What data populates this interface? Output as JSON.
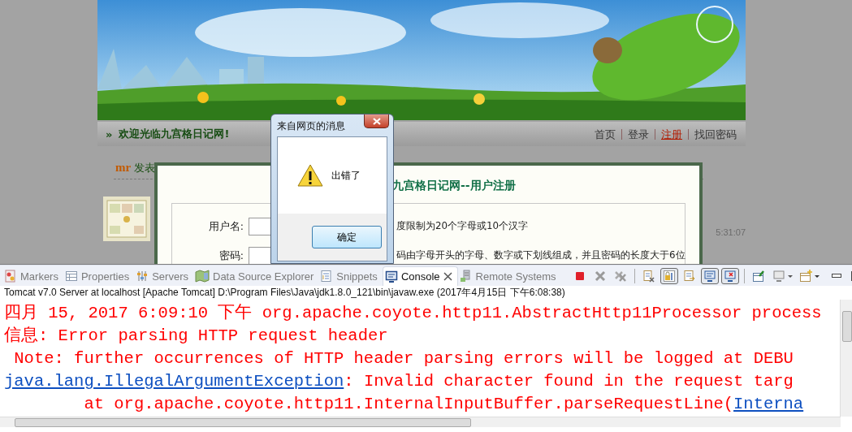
{
  "browser": {
    "welcome_mark": "»",
    "welcome": "欢迎光临九宫格日记网!",
    "nav_links": [
      {
        "label": "首页",
        "selected": false
      },
      {
        "label": "登录",
        "selected": false
      },
      {
        "label": "注册",
        "selected": true
      },
      {
        "label": "找回密码",
        "selected": false
      }
    ],
    "post": {
      "author": "mr",
      "action": "发表",
      "time": "5:31:07"
    },
    "register_dialog": {
      "title": "九宫格日记网--用户注册",
      "fields": [
        {
          "label": "用户名:",
          "hint": "度限制为20个字母或10个汉字"
        },
        {
          "label": "密码:",
          "hint": "码由字母开头的字母、数字或下划线组成，并且密码的长度大于6位"
        }
      ]
    },
    "alert": {
      "title": "来自网页的消息",
      "message": "出错了",
      "button": "确定"
    }
  },
  "ide": {
    "tabs": [
      {
        "label": "Markers",
        "selected": false
      },
      {
        "label": "Properties",
        "selected": false
      },
      {
        "label": "Servers",
        "selected": false
      },
      {
        "label": "Data Source Explorer",
        "selected": false
      },
      {
        "label": "Snippets",
        "selected": false
      },
      {
        "label": "Console",
        "selected": true
      },
      {
        "label": "Remote Systems",
        "selected": false
      }
    ],
    "toolbar": [
      {
        "pressed": false
      },
      {
        "pressed": false
      },
      {
        "pressed": false
      },
      {
        "pressed": false
      },
      {
        "pressed": true
      },
      {
        "pressed": false
      },
      {
        "pressed": true
      },
      {
        "pressed": true
      },
      {
        "pressed": false
      },
      {
        "pressed": false
      },
      {
        "pressed": false
      }
    ],
    "console_title": "Tomcat v7.0 Server at localhost [Apache Tomcat] D:\\Program Files\\Java\\jdk1.8.0_121\\bin\\javaw.exe (2017年4月15日 下午6:08:38)",
    "lines": [
      {
        "segments": [
          {
            "kind": "text",
            "text": "四月 15, 2017 6:09:10 下午 org.apache.coyote.http11.AbstractHttp11Processor process"
          }
        ]
      },
      {
        "segments": [
          {
            "kind": "text",
            "text": "信息: Error parsing HTTP request header"
          }
        ]
      },
      {
        "segments": [
          {
            "kind": "text",
            "text": " Note: further occurrences of HTTP header parsing errors will be logged at DEBU"
          }
        ]
      },
      {
        "segments": [
          {
            "kind": "link",
            "text": "java.lang.IllegalArgumentException"
          },
          {
            "kind": "text",
            "text": ": Invalid character found in the request targ"
          }
        ]
      },
      {
        "segments": [
          {
            "kind": "text",
            "text": "        at org.apache.coyote.http11.InternalInputBuffer.parseRequestLine("
          },
          {
            "kind": "link",
            "text": "Interna"
          }
        ]
      }
    ]
  }
}
